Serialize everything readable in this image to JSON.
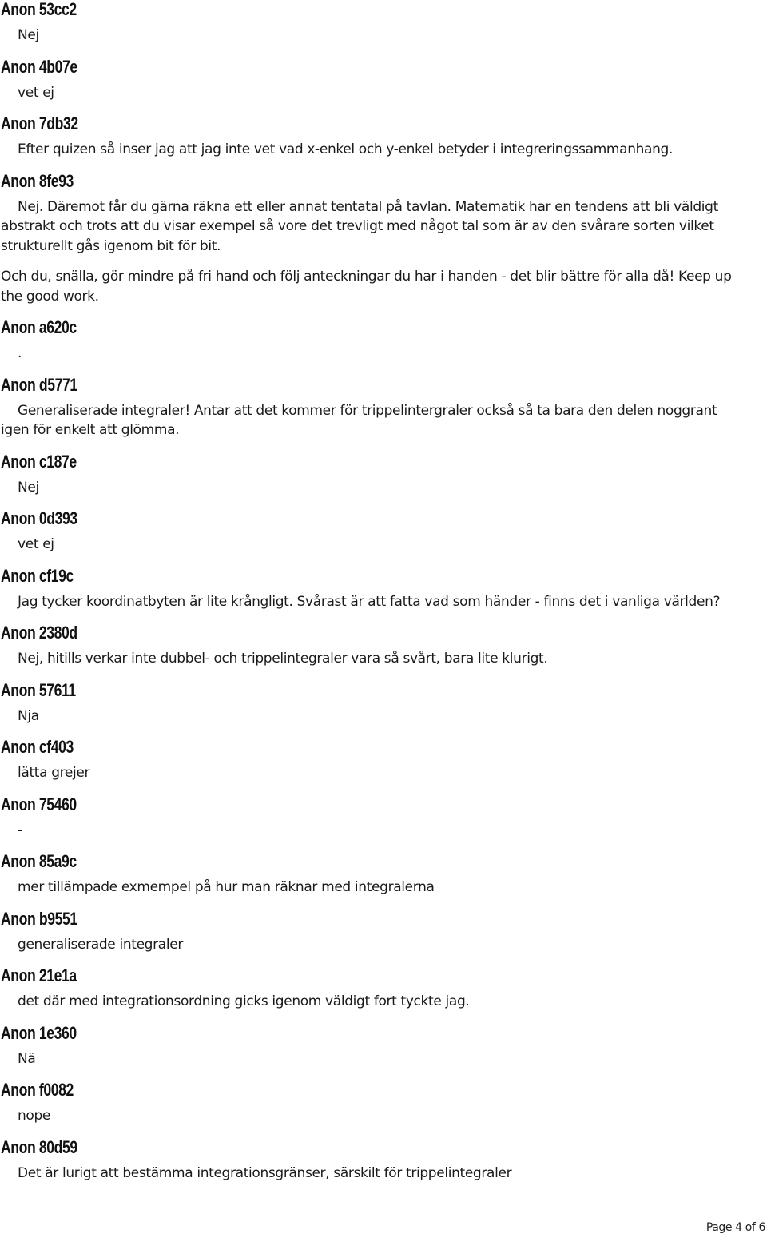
{
  "entries": [
    {
      "author": "Anon 53cc2",
      "paragraphs": [
        "Nej"
      ]
    },
    {
      "author": "Anon 4b07e",
      "paragraphs": [
        "vet ej"
      ]
    },
    {
      "author": "Anon 7db32",
      "paragraphs": [
        "Efter quizen så inser jag att jag inte vet vad x-enkel och y-enkel betyder i integreringssammanhang."
      ]
    },
    {
      "author": "Anon 8fe93",
      "paragraphs": [
        "Nej. Däremot får du gärna räkna ett eller annat tentatal på tavlan. Matematik har en tendens att bli väldigt abstrakt och trots att du visar exempel så vore det trevligt med något tal som är av den svårare sorten vilket strukturellt gås igenom bit för bit.",
        "Och du, snälla, gör mindre på fri hand och följ anteckningar du har i handen - det blir bättre för alla då! Keep up the good work."
      ]
    },
    {
      "author": "Anon a620c",
      "paragraphs": [
        "."
      ]
    },
    {
      "author": "Anon d5771",
      "paragraphs": [
        "Generaliserade integraler! Antar att det kommer för trippelintergraler också så ta bara den delen noggrant igen för enkelt att glömma."
      ]
    },
    {
      "author": "Anon c187e",
      "paragraphs": [
        "Nej"
      ]
    },
    {
      "author": "Anon 0d393",
      "paragraphs": [
        "vet ej"
      ]
    },
    {
      "author": "Anon cf19c",
      "paragraphs": [
        "Jag tycker koordinatbyten är lite krångligt. Svårast är att fatta vad som händer - finns det i vanliga världen?"
      ]
    },
    {
      "author": "Anon 2380d",
      "paragraphs": [
        "Nej, hitills verkar inte dubbel- och trippelintegraler vara så svårt, bara lite klurigt."
      ]
    },
    {
      "author": "Anon 57611",
      "paragraphs": [
        "Nja"
      ]
    },
    {
      "author": "Anon cf403",
      "paragraphs": [
        "lätta grejer"
      ]
    },
    {
      "author": "Anon 75460",
      "paragraphs": [
        "-"
      ]
    },
    {
      "author": "Anon 85a9c",
      "paragraphs": [
        "mer tillämpade exmempel på hur man räknar med integralerna"
      ]
    },
    {
      "author": "Anon b9551",
      "paragraphs": [
        "generaliserade integraler"
      ]
    },
    {
      "author": "Anon 21e1a",
      "paragraphs": [
        "det där med integrationsordning gicks igenom väldigt fort tyckte jag."
      ]
    },
    {
      "author": "Anon 1e360",
      "paragraphs": [
        "Nä"
      ]
    },
    {
      "author": "Anon f0082",
      "paragraphs": [
        "nope"
      ]
    },
    {
      "author": "Anon 80d59",
      "paragraphs": [
        "Det är lurigt att bestämma integrationsgränser, särskilt för trippelintegraler"
      ]
    }
  ],
  "footer": {
    "page_label": "Page 4 of 6"
  }
}
